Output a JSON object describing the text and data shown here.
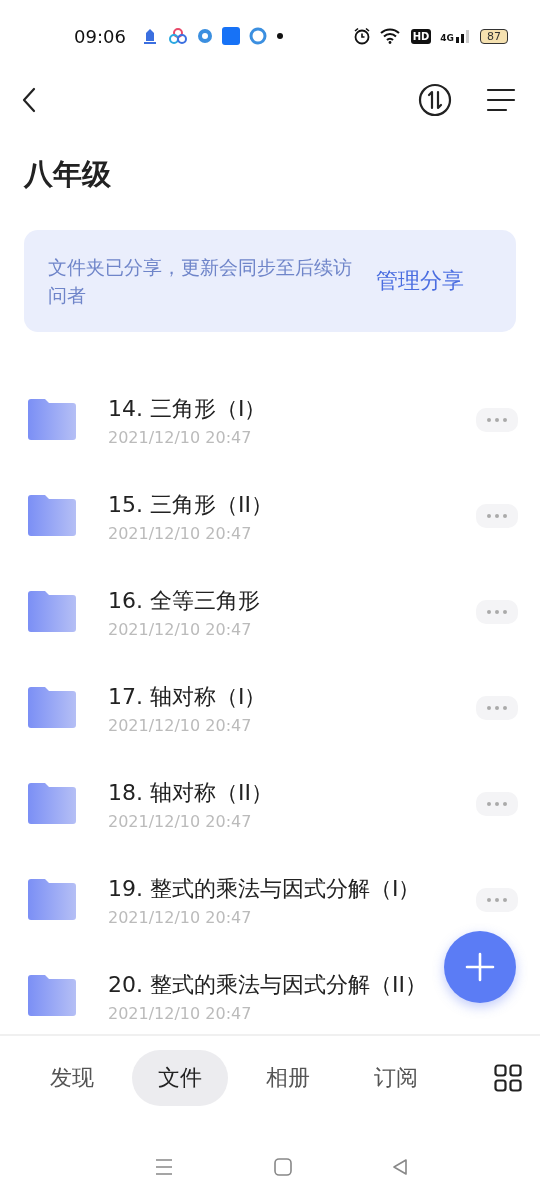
{
  "status_bar": {
    "time": "09:06",
    "network_badge": "HD",
    "signal_label": "4G",
    "battery": "87"
  },
  "title": "八年级",
  "share_banner": {
    "message": "文件夹已分享，更新会同步至后续访问者",
    "action": "管理分享"
  },
  "folders": [
    {
      "name": "14. 三角形（I）",
      "date": "2021/12/10 20:47",
      "more_button": true
    },
    {
      "name": "15. 三角形（II）",
      "date": "2021/12/10 20:47",
      "more_button": true
    },
    {
      "name": "16. 全等三角形",
      "date": "2021/12/10 20:47",
      "more_button": true
    },
    {
      "name": "17. 轴对称（I）",
      "date": "2021/12/10 20:47",
      "more_button": true
    },
    {
      "name": "18. 轴对称（II）",
      "date": "2021/12/10 20:47",
      "more_button": true
    },
    {
      "name": "19. 整式的乘法与因式分解（I）",
      "date": "2021/12/10 20:47",
      "more_button": true
    },
    {
      "name": "20. 整式的乘法与因式分解（II）",
      "date": "2021/12/10 20:47",
      "more_button": false
    }
  ],
  "tabs": [
    {
      "label": "发现",
      "selected": false
    },
    {
      "label": "文件",
      "selected": true
    },
    {
      "label": "相册",
      "selected": false
    },
    {
      "label": "订阅",
      "selected": false
    }
  ]
}
